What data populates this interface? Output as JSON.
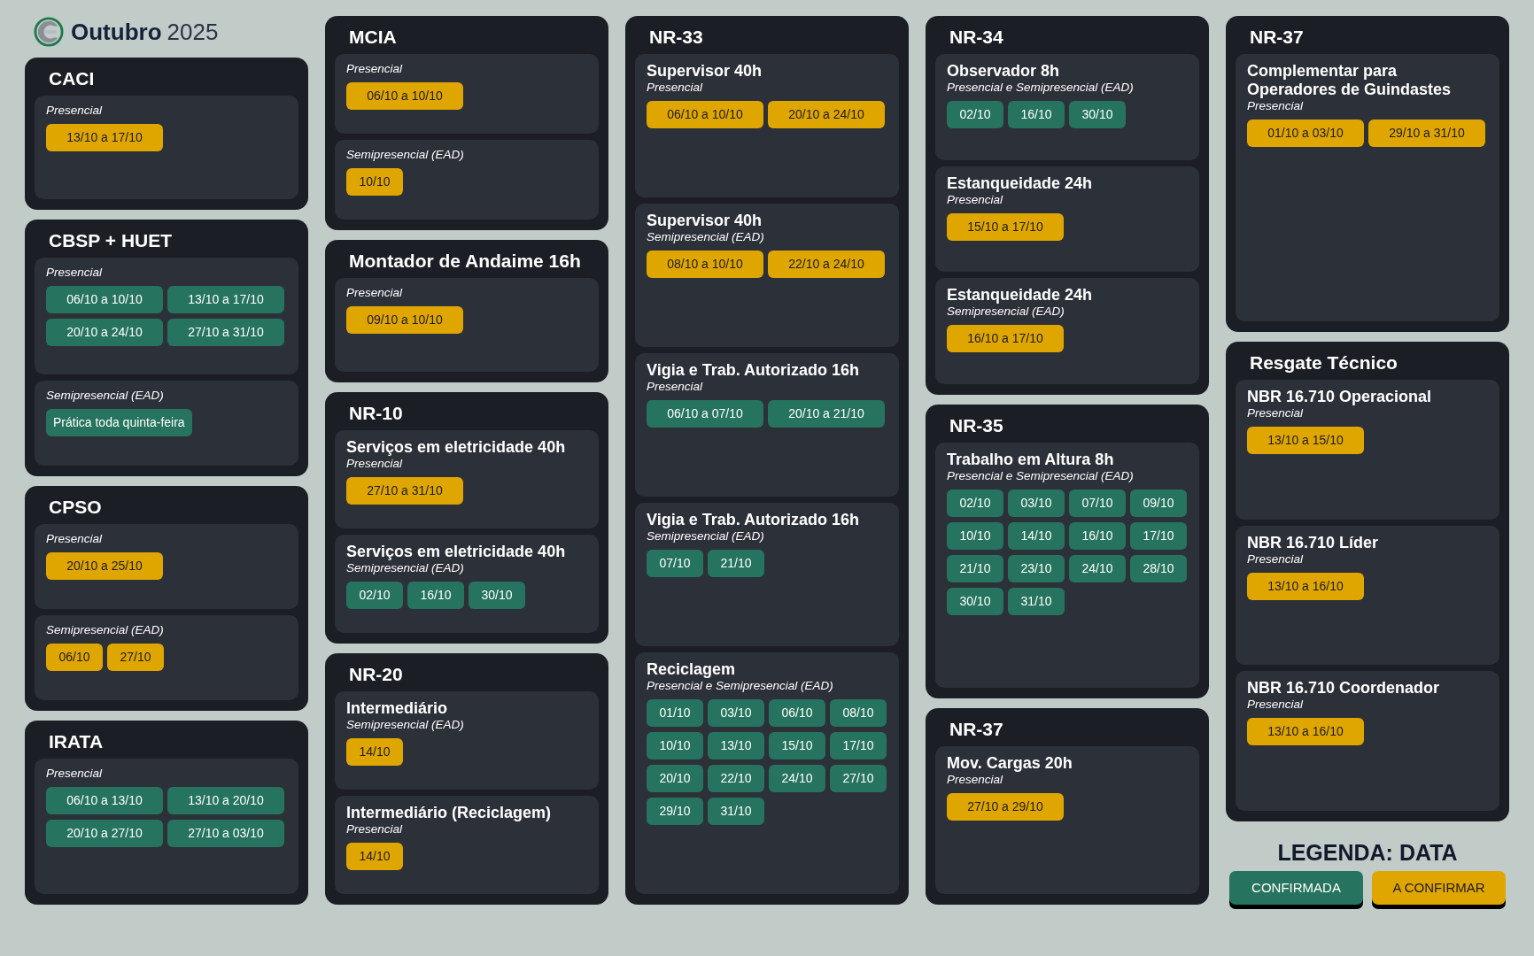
{
  "header": {
    "month": "Outubro",
    "year": "2025"
  },
  "columns": [
    {
      "cards": [
        {
          "title": "CACI",
          "sections": [
            {
              "mode": "Presencial",
              "chips": [
                {
                  "label": "13/10 a 17/10",
                  "kind": "pending"
                }
              ]
            }
          ]
        },
        {
          "title": "CBSP + HUET",
          "sections": [
            {
              "mode": "Presencial",
              "chips": [
                {
                  "label": "06/10 a 10/10",
                  "kind": "confirmed"
                },
                {
                  "label": "13/10 a 17/10",
                  "kind": "confirmed"
                },
                {
                  "label": "20/10 a 24/10",
                  "kind": "confirmed"
                },
                {
                  "label": "27/10 a 31/10",
                  "kind": "confirmed"
                }
              ]
            },
            {
              "mode": "Semipresencial (EAD)",
              "chips": [
                {
                  "label": "Prática toda quinta-feira",
                  "kind": "confirmed"
                }
              ]
            }
          ]
        },
        {
          "title": "CPSO",
          "sections": [
            {
              "mode": "Presencial",
              "chips": [
                {
                  "label": "20/10 a 25/10",
                  "kind": "pending"
                }
              ]
            },
            {
              "mode": "Semipresencial (EAD)",
              "chips": [
                {
                  "label": "06/10",
                  "kind": "pending"
                },
                {
                  "label": "27/10",
                  "kind": "pending"
                }
              ]
            }
          ]
        },
        {
          "title": "IRATA",
          "sections": [
            {
              "mode": "Presencial",
              "chips": [
                {
                  "label": "06/10 a 13/10",
                  "kind": "confirmed"
                },
                {
                  "label": "13/10 a 20/10",
                  "kind": "confirmed"
                },
                {
                  "label": "20/10 a 27/10",
                  "kind": "confirmed"
                },
                {
                  "label": "27/10 a 03/10",
                  "kind": "confirmed"
                }
              ]
            }
          ]
        }
      ]
    },
    {
      "cards": [
        {
          "title": "MCIA",
          "sections": [
            {
              "mode": "Presencial",
              "chips": [
                {
                  "label": "06/10 a 10/10",
                  "kind": "pending"
                }
              ]
            },
            {
              "mode": "Semipresencial (EAD)",
              "chips": [
                {
                  "label": "10/10",
                  "kind": "pending"
                }
              ]
            }
          ]
        },
        {
          "title": "Montador de Andaime 16h",
          "sections": [
            {
              "mode": "Presencial",
              "chips": [
                {
                  "label": "09/10 a 10/10",
                  "kind": "pending"
                }
              ]
            }
          ]
        },
        {
          "title": "NR-10",
          "sections": [
            {
              "course": "Serviços em eletricidade 40h",
              "mode": "Presencial",
              "chips": [
                {
                  "label": "27/10 a 31/10",
                  "kind": "pending"
                }
              ]
            },
            {
              "course": "Serviços em eletricidade 40h",
              "mode": "Semipresencial (EAD)",
              "chips": [
                {
                  "label": "02/10",
                  "kind": "confirmed"
                },
                {
                  "label": "16/10",
                  "kind": "confirmed"
                },
                {
                  "label": "30/10",
                  "kind": "confirmed"
                }
              ]
            }
          ]
        },
        {
          "title": "NR-20",
          "sections": [
            {
              "course": "Intermediário",
              "mode": "Semipresencial (EAD)",
              "chips": [
                {
                  "label": "14/10",
                  "kind": "pending"
                }
              ]
            },
            {
              "course": "Intermediário (Reciclagem)",
              "mode": "Presencial",
              "chips": [
                {
                  "label": "14/10",
                  "kind": "pending"
                }
              ]
            }
          ]
        }
      ]
    },
    {
      "cards": [
        {
          "title": "NR-33",
          "sections": [
            {
              "course": "Supervisor 40h",
              "mode": "Presencial",
              "chips": [
                {
                  "label": "06/10 a 10/10",
                  "kind": "pending"
                },
                {
                  "label": "20/10 a 24/10",
                  "kind": "pending"
                }
              ]
            },
            {
              "course": "Supervisor 40h",
              "mode": "Semipresencial (EAD)",
              "chips": [
                {
                  "label": "08/10 a 10/10",
                  "kind": "pending"
                },
                {
                  "label": "22/10 a 24/10",
                  "kind": "pending"
                }
              ]
            },
            {
              "course": "Vigia e Trab. Autorizado 16h",
              "mode": "Presencial",
              "chips": [
                {
                  "label": "06/10 a 07/10",
                  "kind": "confirmed"
                },
                {
                  "label": "20/10 a 21/10",
                  "kind": "confirmed"
                }
              ]
            },
            {
              "course": "Vigia e Trab. Autorizado 16h",
              "mode": "Semipresencial (EAD)",
              "chips": [
                {
                  "label": "07/10",
                  "kind": "confirmed"
                },
                {
                  "label": "21/10",
                  "kind": "confirmed"
                }
              ]
            },
            {
              "course": "Reciclagem",
              "mode": "Presencial e Semipresencial (EAD)",
              "chips": [
                {
                  "label": "01/10",
                  "kind": "confirmed"
                },
                {
                  "label": "03/10",
                  "kind": "confirmed"
                },
                {
                  "label": "06/10",
                  "kind": "confirmed"
                },
                {
                  "label": "08/10",
                  "kind": "confirmed"
                },
                {
                  "label": "10/10",
                  "kind": "confirmed"
                },
                {
                  "label": "13/10",
                  "kind": "confirmed"
                },
                {
                  "label": "15/10",
                  "kind": "confirmed"
                },
                {
                  "label": "17/10",
                  "kind": "confirmed"
                },
                {
                  "label": "20/10",
                  "kind": "confirmed"
                },
                {
                  "label": "22/10",
                  "kind": "confirmed"
                },
                {
                  "label": "24/10",
                  "kind": "confirmed"
                },
                {
                  "label": "27/10",
                  "kind": "confirmed"
                },
                {
                  "label": "29/10",
                  "kind": "confirmed"
                },
                {
                  "label": "31/10",
                  "kind": "confirmed"
                }
              ]
            }
          ]
        }
      ]
    },
    {
      "cards": [
        {
          "title": "NR-34",
          "sections": [
            {
              "course": "Observador 8h",
              "mode": "Presencial e Semipresencial (EAD)",
              "chips": [
                {
                  "label": "02/10",
                  "kind": "confirmed"
                },
                {
                  "label": "16/10",
                  "kind": "confirmed"
                },
                {
                  "label": "30/10",
                  "kind": "confirmed"
                }
              ]
            },
            {
              "course": "Estanqueidade 24h",
              "mode": "Presencial",
              "chips": [
                {
                  "label": "15/10 a 17/10",
                  "kind": "pending"
                }
              ]
            },
            {
              "course": "Estanqueidade 24h",
              "mode": "Semipresencial (EAD)",
              "chips": [
                {
                  "label": "16/10 a 17/10",
                  "kind": "pending"
                }
              ]
            }
          ]
        },
        {
          "title": "NR-35",
          "sections": [
            {
              "course": "Trabalho em Altura 8h",
              "mode": "Presencial e Semipresencial (EAD)",
              "chips": [
                {
                  "label": "02/10",
                  "kind": "confirmed"
                },
                {
                  "label": "03/10",
                  "kind": "confirmed"
                },
                {
                  "label": "07/10",
                  "kind": "confirmed"
                },
                {
                  "label": "09/10",
                  "kind": "confirmed"
                },
                {
                  "label": "10/10",
                  "kind": "confirmed"
                },
                {
                  "label": "14/10",
                  "kind": "confirmed"
                },
                {
                  "label": "16/10",
                  "kind": "confirmed"
                },
                {
                  "label": "17/10",
                  "kind": "confirmed"
                },
                {
                  "label": "21/10",
                  "kind": "confirmed"
                },
                {
                  "label": "23/10",
                  "kind": "confirmed"
                },
                {
                  "label": "24/10",
                  "kind": "confirmed"
                },
                {
                  "label": "28/10",
                  "kind": "confirmed"
                },
                {
                  "label": "30/10",
                  "kind": "confirmed"
                },
                {
                  "label": "31/10",
                  "kind": "confirmed"
                }
              ]
            }
          ]
        },
        {
          "title": "NR-37",
          "sections": [
            {
              "course": "Mov. Cargas 20h",
              "mode": "Presencial",
              "chips": [
                {
                  "label": "27/10 a 29/10",
                  "kind": "pending"
                }
              ]
            }
          ]
        }
      ]
    },
    {
      "cards": [
        {
          "title": "NR-37",
          "sections": [
            {
              "course": "Complementar para Operadores de Guindastes",
              "mode": "Presencial",
              "chips": [
                {
                  "label": "01/10 a 03/10",
                  "kind": "pending"
                },
                {
                  "label": "29/10 a 31/10",
                  "kind": "pending"
                }
              ]
            }
          ]
        },
        {
          "title": "Resgate Técnico",
          "sections": [
            {
              "course": "NBR 16.710 Operacional",
              "mode": "Presencial",
              "chips": [
                {
                  "label": "13/10 a 15/10",
                  "kind": "pending"
                }
              ]
            },
            {
              "course": "NBR 16.710 Líder",
              "mode": "Presencial",
              "chips": [
                {
                  "label": "13/10 a 16/10",
                  "kind": "pending"
                }
              ]
            },
            {
              "course": "NBR 16.710 Coordenador",
              "mode": "Presencial",
              "chips": [
                {
                  "label": "13/10 a 16/10",
                  "kind": "pending"
                }
              ]
            }
          ]
        }
      ]
    }
  ],
  "legend": {
    "title": "LEGENDA: DATA",
    "items": [
      {
        "label": "CONFIRMADA",
        "kind": "confirmed"
      },
      {
        "label": "A CONFIRMAR",
        "kind": "pending"
      }
    ]
  }
}
